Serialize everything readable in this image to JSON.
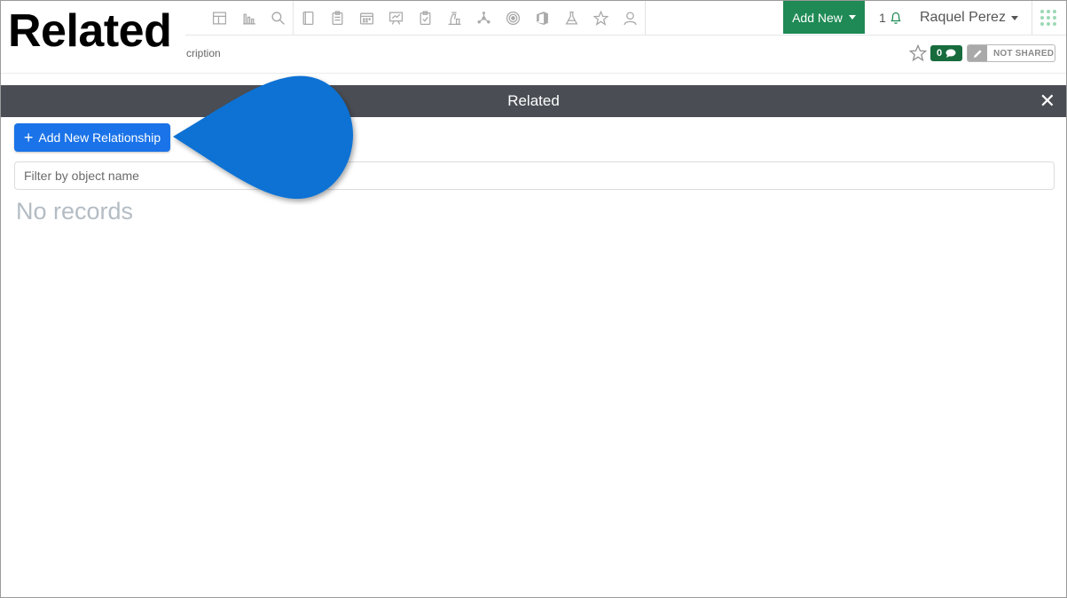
{
  "callout": {
    "title": "Related"
  },
  "topbar": {
    "icons": [
      "dashboard-icon",
      "bar-chart-icon",
      "search-icon",
      "notebook-icon",
      "clipboard-icon",
      "calendar-icon",
      "presentation-icon",
      "checklist-icon",
      "lab-bench-icon",
      "molecule-icon",
      "target-icon",
      "office-icon",
      "flask-icon",
      "star-icon",
      "user-icon"
    ],
    "add_new_label": "Add New",
    "notification_count": "1",
    "user_name": "Raquel Perez"
  },
  "subbar": {
    "breadcrumb_tail": "cription",
    "comment_count": "0",
    "share_status": "NOT SHARED"
  },
  "panel": {
    "title": "Related",
    "close_symbol": "✕",
    "add_button_label": "Add New Relationship",
    "add_button_plus": "+",
    "filter_placeholder": "Filter by object name",
    "empty_text": "No records"
  },
  "colors": {
    "add_new_bg": "#1f8a55",
    "panel_header_bg": "#4a4e54",
    "primary_button": "#1a73e8",
    "callout_pointer": "#0a72d4",
    "comment_badge": "#176b3d"
  }
}
